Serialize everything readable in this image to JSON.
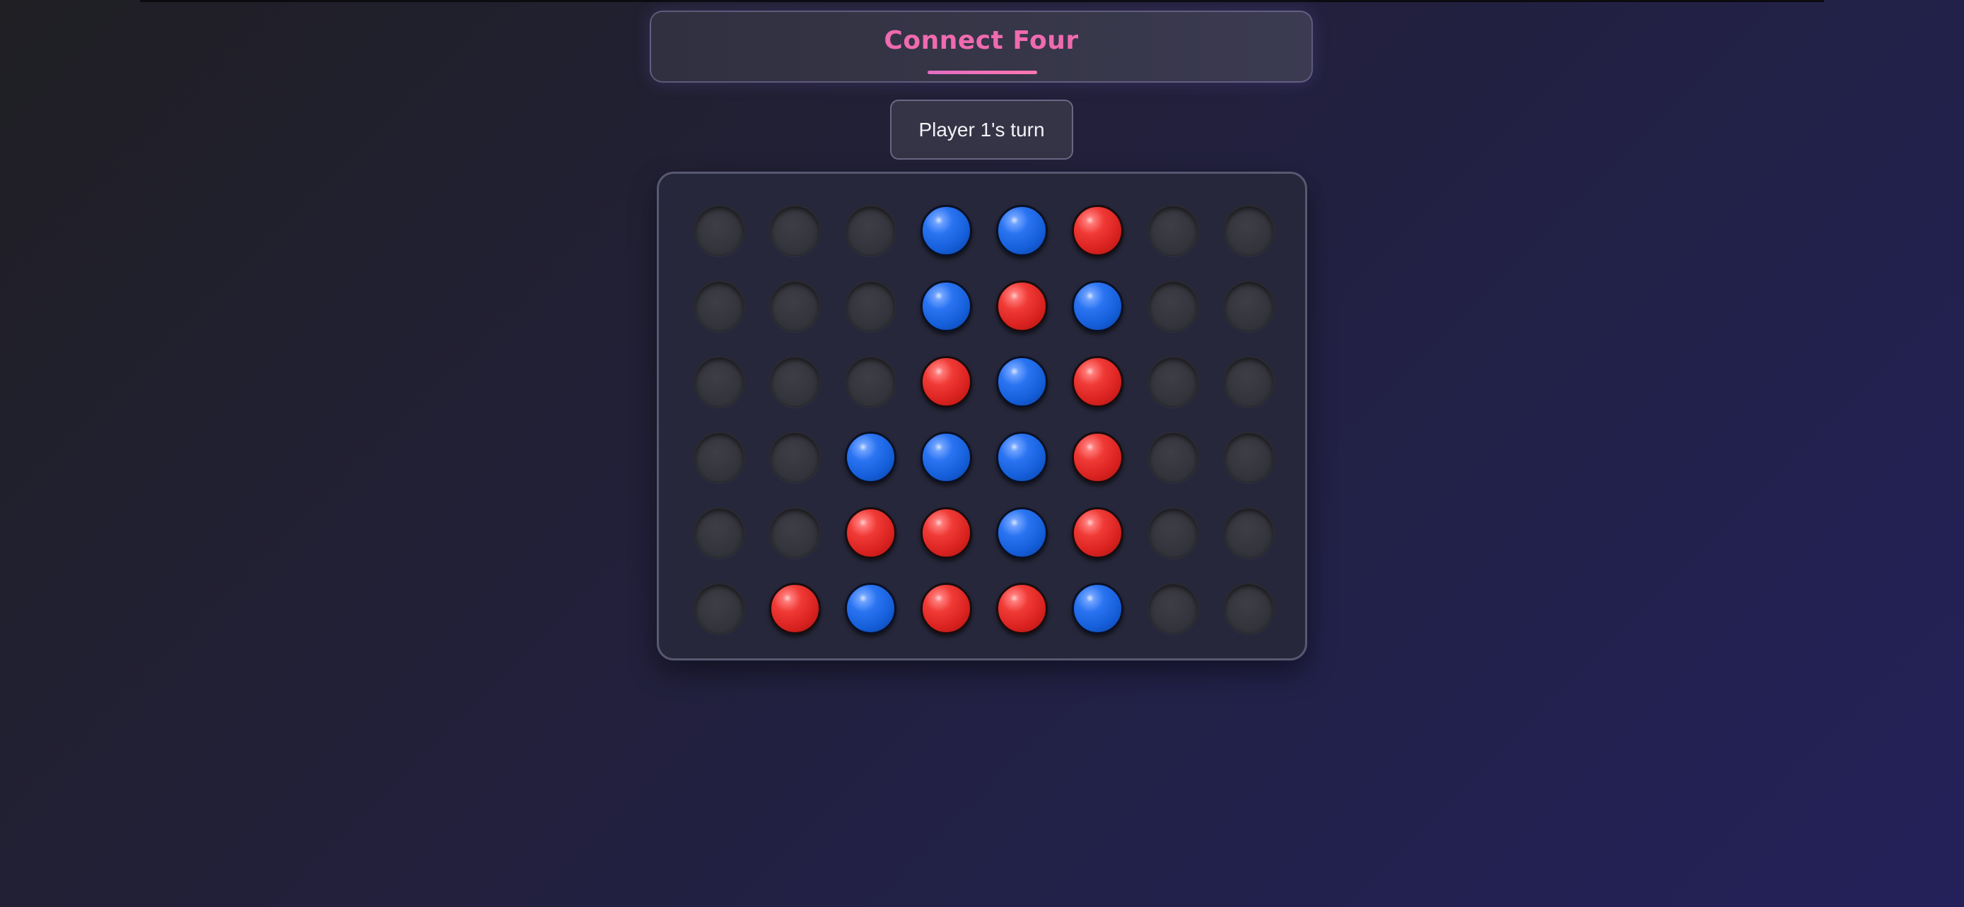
{
  "game": {
    "title": "Connect Four",
    "status": "Player 1's turn"
  },
  "colors": {
    "title": "#f06ab0",
    "red_piece": "#e52a26",
    "blue_piece": "#1f6ae6",
    "empty_slot": "#38383f"
  },
  "board": {
    "columns": 8,
    "rows": 6,
    "cells": [
      [
        "empty",
        "empty",
        "empty",
        "blue",
        "blue",
        "red",
        "empty",
        "empty"
      ],
      [
        "empty",
        "empty",
        "empty",
        "blue",
        "red",
        "blue",
        "empty",
        "empty"
      ],
      [
        "empty",
        "empty",
        "empty",
        "red",
        "blue",
        "red",
        "empty",
        "empty"
      ],
      [
        "empty",
        "empty",
        "blue",
        "blue",
        "blue",
        "red",
        "empty",
        "empty"
      ],
      [
        "empty",
        "empty",
        "red",
        "red",
        "blue",
        "red",
        "empty",
        "empty"
      ],
      [
        "empty",
        "red",
        "blue",
        "red",
        "red",
        "blue",
        "empty",
        "empty"
      ]
    ]
  }
}
